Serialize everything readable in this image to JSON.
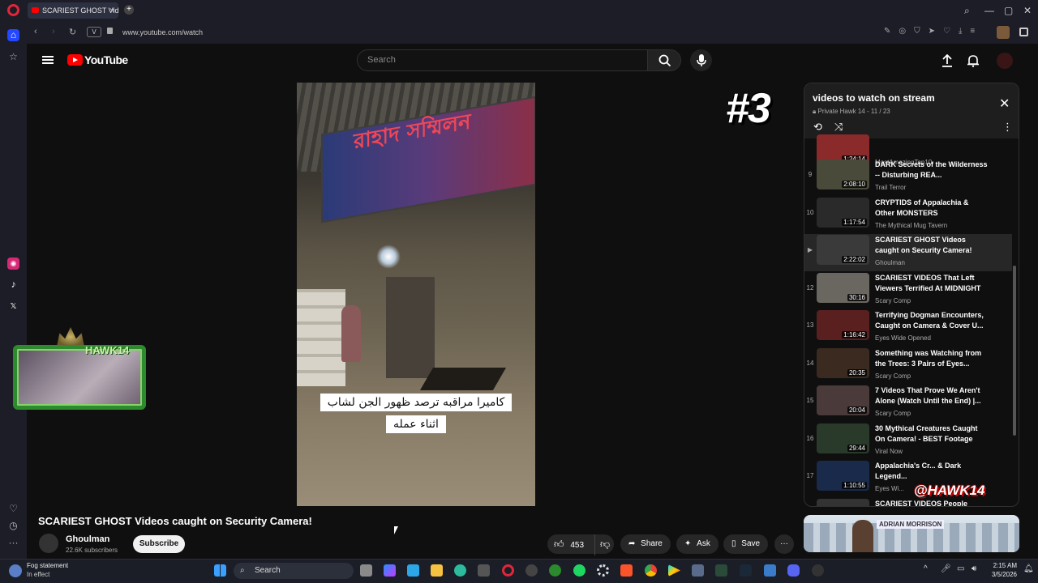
{
  "browser": {
    "tab_title": "SCARIEST GHOST Vid...",
    "site_info": "V",
    "url": "www.youtube.com/watch"
  },
  "youtube": {
    "logo_text": "YouTube",
    "search_placeholder": "Search"
  },
  "video": {
    "caption_line1": "كاميرا مراقبه ترصد ظهور الجن لشاب",
    "caption_line2": "اثناء عمله",
    "banner_text": "রাহাদ সম্মিলন",
    "overlay_number": "#3",
    "title": "SCARIEST GHOST Videos caught on Security Camera!",
    "channel": "Ghoulman",
    "subscribers": "22.6K subscribers",
    "subscribe_label": "Subscribe",
    "likes": "453",
    "share_label": "Share",
    "ask_label": "Ask",
    "save_label": "Save"
  },
  "stream_overlay": {
    "cam_label": "HAWK14",
    "watermark": "@HAWK14"
  },
  "playlist": {
    "title": "videos to watch on stream",
    "subtitle": "Private Hawk 14 - 11 / 23",
    "items": [
      {
        "index": "",
        "title": "",
        "channel": "MostAmazingTop10",
        "duration": "1:24:14",
        "color": "#8a2a2a"
      },
      {
        "index": "9",
        "title": "DARK Secrets of the Wilderness -- Disturbing REA...",
        "channel": "Trail Terror",
        "duration": "2:08:10",
        "color": "#4a4a3a"
      },
      {
        "index": "10",
        "title": "CRYPTIDS of Appalachia & Other MONSTERS",
        "channel": "The Mythical Mug Tavern",
        "duration": "1:17:54",
        "color": "#2a2a2a"
      },
      {
        "index": "▶",
        "title": "SCARIEST GHOST Videos caught on Security Camera!",
        "channel": "Ghoulman",
        "duration": "2:22:02",
        "color": "#3a3a3a"
      },
      {
        "index": "12",
        "title": "SCARIEST VIDEOS That Left Viewers Terrified At MIDNIGHT",
        "channel": "Scary Comp",
        "duration": "30:16",
        "color": "#6a6660"
      },
      {
        "index": "13",
        "title": "Terrifying Dogman Encounters, Caught on Camera & Cover U...",
        "channel": "Eyes Wide Opened",
        "duration": "1:16:42",
        "color": "#5a2020"
      },
      {
        "index": "14",
        "title": "Something was Watching from the Trees: 3 Pairs of Eyes...",
        "channel": "Scary Comp",
        "duration": "20:35",
        "color": "#3a2a20"
      },
      {
        "index": "15",
        "title": "7 Videos That Prove We Aren't Alone (Watch Until the End) |...",
        "channel": "Scary Comp",
        "duration": "20:04",
        "color": "#4a3a3a"
      },
      {
        "index": "16",
        "title": "30 Mythical Creatures Caught On Camera! - BEST Footage",
        "channel": "Viral Now",
        "duration": "29:44",
        "color": "#2a3a2a"
      },
      {
        "index": "17",
        "title": "Appalachia's Cr... & Dark Legend...",
        "channel": "Eyes Wi...",
        "duration": "1:10:55",
        "color": "#1a2a4a"
      },
      {
        "index": "",
        "title": "SCARIEST VIDEOS People",
        "channel": "",
        "duration": "",
        "color": "#333"
      }
    ]
  },
  "ad": {
    "name": "ADRIAN MORRISON"
  },
  "taskbar": {
    "weather_title": "Fog statement",
    "weather_sub": "In effect",
    "search_label": "Search",
    "time": "2:15 AM",
    "date": "3/5/2026"
  }
}
